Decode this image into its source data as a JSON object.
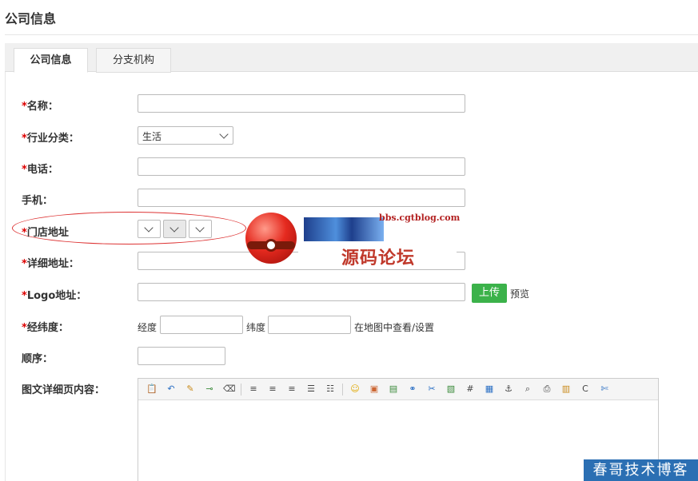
{
  "page": {
    "title": "公司信息"
  },
  "tabs": [
    {
      "label": "公司信息",
      "active": true
    },
    {
      "label": "分支机构",
      "active": false
    }
  ],
  "form": {
    "required_mark": "*",
    "name_label": "名称：",
    "industry_label": "行业分类：",
    "industry_value": "生活",
    "phone_label": "电话：",
    "mobile_label": "手机：",
    "store_address_label": "门店地址",
    "detail_address_label": "详细地址：",
    "logo_label": "Logo地址：",
    "upload_button": "上传",
    "preview_label": "预览",
    "coords_label": "经纬度：",
    "longitude_label": "经度",
    "latitude_label": "纬度",
    "map_link": "在地图中查看/设置",
    "order_label": "顺序：",
    "rich_content_label": "图文详细页内容："
  },
  "editor": {
    "toolbar_icons": [
      "paste-icon",
      "undo-icon",
      "clear-format-icon",
      "format-painter-icon",
      "eraser-icon",
      "align-left-icon",
      "align-center-icon",
      "align-right-icon",
      "ordered-list-icon",
      "unordered-list-icon",
      "emoticon-icon",
      "insert-image-icon",
      "insert-flash-icon",
      "link-icon",
      "unlink-icon",
      "image-icon",
      "hr-icon",
      "table-icon",
      "anchor-icon",
      "preview-icon",
      "print-icon",
      "template-icon",
      "code-icon",
      "cut-icon"
    ]
  },
  "overlay": {
    "site_url": "bbs.cgtblog.com",
    "site_name": "源码论坛",
    "watermark": "春哥技术博客"
  },
  "colors": {
    "required": "#dd0000",
    "upload_button": "#3bb24a",
    "annotation": "#dd3333",
    "watermark_bg": "#2b6fb3"
  }
}
